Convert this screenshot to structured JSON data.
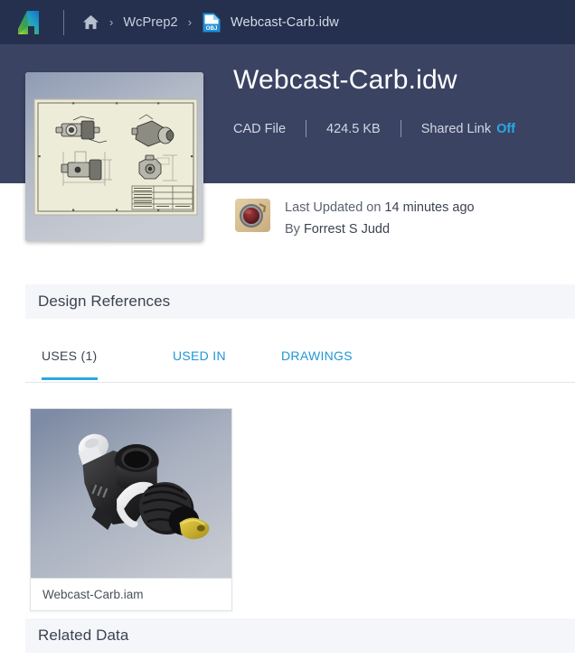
{
  "topbar": {
    "logo_name": "autodesk-logo",
    "home_label": "Home",
    "separator": "›",
    "breadcrumbs": [
      {
        "label": "WcPrep2"
      }
    ],
    "file_icon_text": "OBJ",
    "current_file": "Webcast-Carb.idw"
  },
  "hero": {
    "title": "Webcast-Carb.idw",
    "file_type": "CAD File",
    "file_size": "424.5 KB",
    "shared_link_label": "Shared Link",
    "shared_link_state": "Off",
    "thumbnail_name": "cad-drawing-thumbnail"
  },
  "updated": {
    "prefix": "Last Updated on",
    "when": "14 minutes ago",
    "by_word": "By",
    "author": "Forrest S Judd",
    "avatar_name": "user-avatar"
  },
  "design_references": {
    "title": "Design References",
    "tabs": [
      {
        "label": "USES (1)",
        "active": true
      },
      {
        "label": "USED IN",
        "active": false
      },
      {
        "label": "DRAWINGS",
        "active": false
      }
    ],
    "cards": [
      {
        "label": "Webcast-Carb.iam",
        "thumbnail_name": "carburetor-render"
      }
    ]
  },
  "related_data": {
    "title": "Related Data"
  },
  "colors": {
    "topbar_bg": "#25304f",
    "hero_bg": "#3b4363",
    "accent_blue": "#29a8e0",
    "link_blue": "#2196d6",
    "section_bar_bg": "#f5f6fa",
    "text_dark": "#3c4350"
  }
}
